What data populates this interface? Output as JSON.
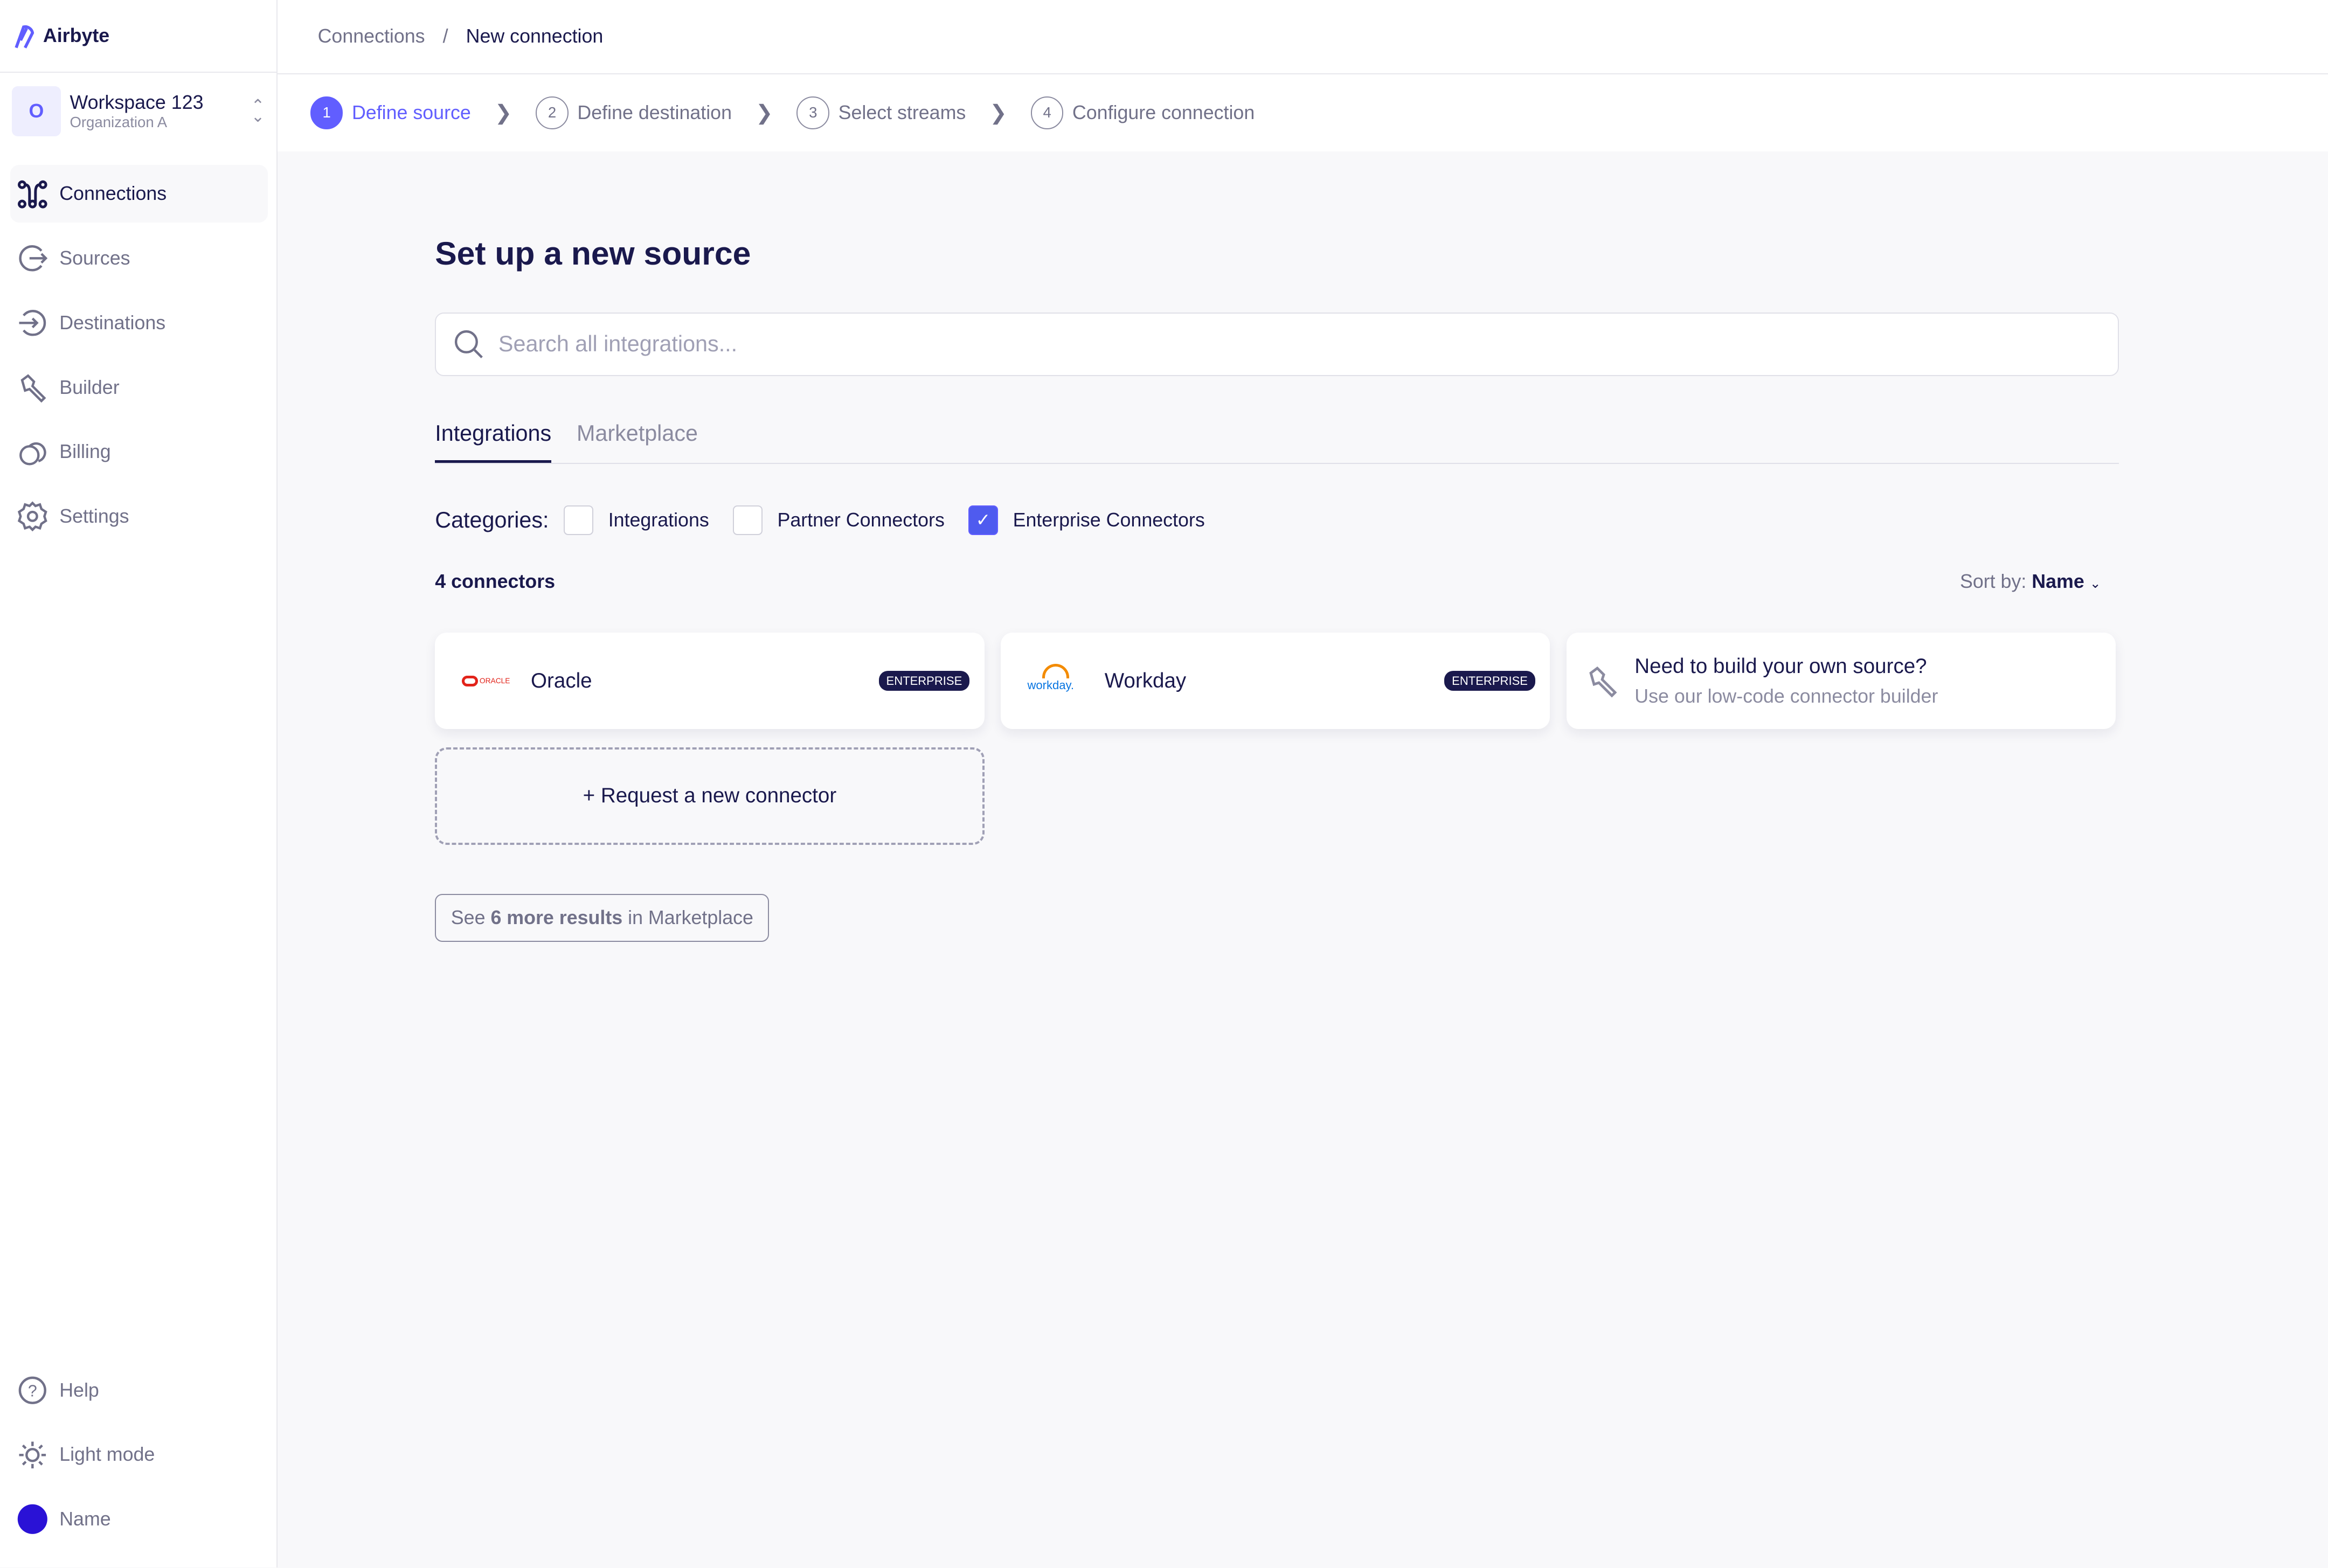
{
  "app": {
    "name": "Airbyte",
    "accent": "#615eff"
  },
  "workspace": {
    "initial": "O",
    "name": "Workspace 123",
    "org": "Organization A"
  },
  "nav": [
    {
      "label": "Connections",
      "icon": "connections-icon",
      "active": true
    },
    {
      "label": "Sources",
      "icon": "sources-icon"
    },
    {
      "label": "Destinations",
      "icon": "destinations-icon"
    },
    {
      "label": "Builder",
      "icon": "wrench-icon"
    },
    {
      "label": "Billing",
      "icon": "billing-icon"
    },
    {
      "label": "Settings",
      "icon": "gear-icon"
    }
  ],
  "bottom_nav": [
    {
      "label": "Help",
      "icon": "help-icon"
    },
    {
      "label": "Light mode",
      "icon": "sun-icon"
    },
    {
      "label": "Name",
      "icon": "avatar"
    }
  ],
  "breadcrumb": [
    "Connections",
    "New connection"
  ],
  "steps": [
    {
      "num": "1",
      "label": "Define source"
    },
    {
      "num": "2",
      "label": "Define destination"
    },
    {
      "num": "3",
      "label": "Select streams"
    },
    {
      "num": "4",
      "label": "Configure connection"
    }
  ],
  "main": {
    "title": "Set up a new source",
    "search_placeholder": "Search all integrations...",
    "tabs": [
      "Integrations",
      "Marketplace"
    ],
    "categories_label": "Categories:",
    "categories": [
      {
        "label": "Integrations",
        "checked": false
      },
      {
        "label": "Partner Connectors",
        "checked": false
      },
      {
        "label": "Enterprise Connectors",
        "checked": true
      }
    ],
    "count": "4 connectors",
    "sort_label": "Sort by:",
    "sort_value": "Name",
    "connectors": [
      {
        "name": "Oracle",
        "badge": "ENTERPRISE",
        "logo": "ORACLE"
      },
      {
        "name": "Workday",
        "badge": "ENTERPRISE",
        "logo": "workday."
      }
    ],
    "builder": {
      "title": "Need to build your own source?",
      "subtitle": "Use our low-code connector builder"
    },
    "request": "+ Request a new connector",
    "more": {
      "pre": "See",
      "bold": "6 more results",
      "post": "in Marketplace"
    }
  }
}
